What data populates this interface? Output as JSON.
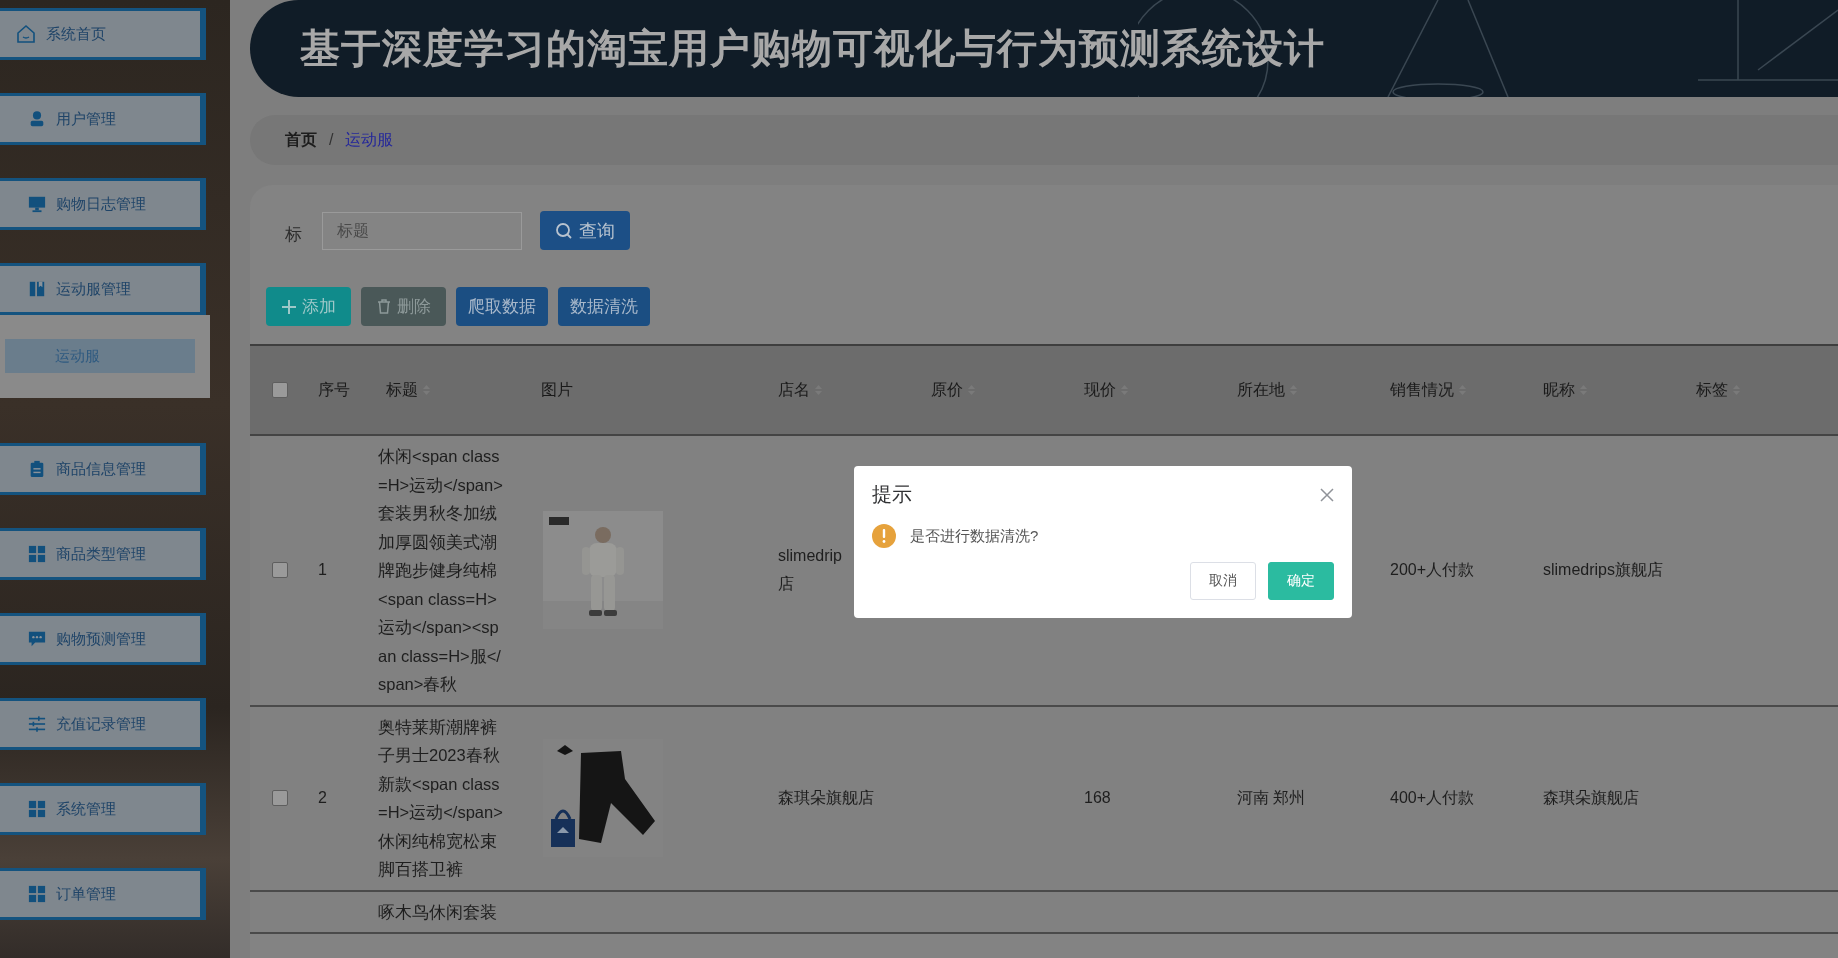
{
  "sidebar": {
    "items": [
      {
        "label": "系统首页",
        "expanded": false
      },
      {
        "label": "用户管理",
        "expanded": false
      },
      {
        "label": "购物日志管理",
        "expanded": false
      },
      {
        "label": "运动服管理",
        "expanded": true,
        "children": [
          {
            "label": "运动服",
            "selected": true
          }
        ]
      },
      {
        "label": "商品信息管理",
        "expanded": false
      },
      {
        "label": "商品类型管理",
        "expanded": false
      },
      {
        "label": "购物预测管理",
        "expanded": false
      },
      {
        "label": "充值记录管理",
        "expanded": false
      },
      {
        "label": "系统管理",
        "expanded": false
      },
      {
        "label": "订单管理",
        "expanded": false
      }
    ]
  },
  "header": {
    "title": "基于深度学习的淘宝用户购物可视化与行为预测系统设计"
  },
  "breadcrumb": {
    "separator": "/",
    "items": [
      {
        "label": "首页",
        "current": false
      },
      {
        "label": "运动服",
        "current": true
      }
    ]
  },
  "search": {
    "label": "标",
    "placeholder": "标题",
    "button": "查询"
  },
  "toolbar": [
    {
      "label": "添加",
      "kind": "add"
    },
    {
      "label": "删除",
      "kind": "delete"
    },
    {
      "label": "爬取数据",
      "kind": "plain"
    },
    {
      "label": "数据清洗",
      "kind": "plain"
    }
  ],
  "table": {
    "select_all": {
      "checked": false
    },
    "columns": [
      {
        "label": "序号",
        "sortable": false
      },
      {
        "label": "标题",
        "sortable": true
      },
      {
        "label": "图片",
        "sortable": false
      },
      {
        "label": "店名",
        "sortable": true
      },
      {
        "label": "原价",
        "sortable": true
      },
      {
        "label": "现价",
        "sortable": true
      },
      {
        "label": "所在地",
        "sortable": true
      },
      {
        "label": "销售情况",
        "sortable": true
      },
      {
        "label": "昵称",
        "sortable": true
      },
      {
        "label": "标签",
        "sortable": true
      }
    ],
    "rows": [
      {
        "checked": false,
        "index": "1",
        "title": "休闲<span class=H>运动</span>套装男秋冬加绒加厚圆领美式潮牌跑步健身纯棉<span class=H>运动</span><span class=H>服</span>春秋",
        "shop": "slimedrip\n店",
        "sales": "200+人付款",
        "nickname": "slimedrips旗舰店"
      },
      {
        "checked": false,
        "index": "2",
        "title": "奥特莱斯潮牌裤子男士2023春秋新款<span class=H>运动</span>休闲纯棉宽松束脚百搭卫裤",
        "shop": "森琪朵旗舰店",
        "current_price": "168",
        "location": "河南 郑州",
        "sales": "400+人付款",
        "nickname": "森琪朵旗舰店"
      },
      {
        "title": "啄木鸟休闲套装"
      }
    ]
  },
  "dialog": {
    "title": "提示",
    "message": "是否进行数据清洗?",
    "buttons": [
      {
        "label": "取消",
        "kind": "cancel"
      },
      {
        "label": "确定",
        "kind": "primary"
      }
    ]
  }
}
